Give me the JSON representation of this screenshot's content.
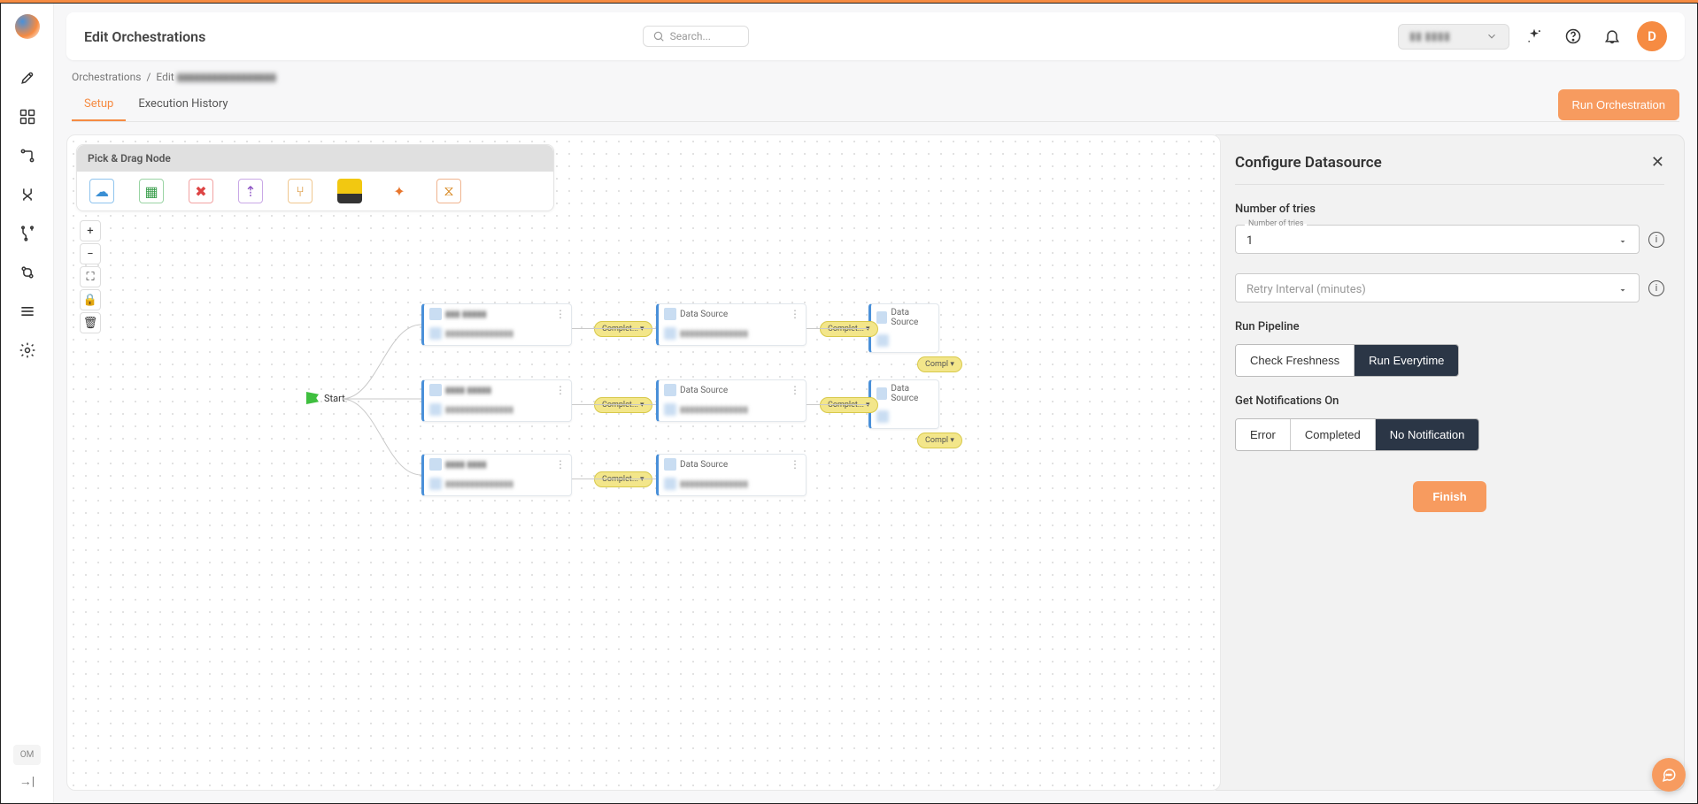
{
  "header": {
    "title": "Edit Orchestrations",
    "search_placeholder": "Search...",
    "env_label": "▮▮ ▮▮▮▮",
    "avatar_letter": "D"
  },
  "breadcrumb": {
    "root": "Orchestrations",
    "sep": "/",
    "current_prefix": "Edit",
    "current_blur": "▮▮▮▮▮▮▮▮▮▮▮▮▮▮▮▮▮"
  },
  "tabs": {
    "setup": "Setup",
    "history": "Execution History",
    "run_btn": "Run Orchestration"
  },
  "palette": {
    "title": "Pick & Drag Node"
  },
  "flow": {
    "start_label": "Start",
    "node_label_ds": "Data Source",
    "pill_label": "Complet..."
  },
  "config": {
    "title": "Configure Datasource",
    "tries_label": "Number of tries",
    "tries_field_label": "Number of tries",
    "tries_value": "1",
    "retry_label": "Retry Interval (minutes)",
    "run_pipeline_label": "Run Pipeline",
    "run_opt_fresh": "Check Freshness",
    "run_opt_every": "Run Everytime",
    "notify_label": "Get Notifications On",
    "notify_error": "Error",
    "notify_completed": "Completed",
    "notify_none": "No Notification",
    "finish": "Finish"
  },
  "sidebar": {
    "om": "OM"
  }
}
